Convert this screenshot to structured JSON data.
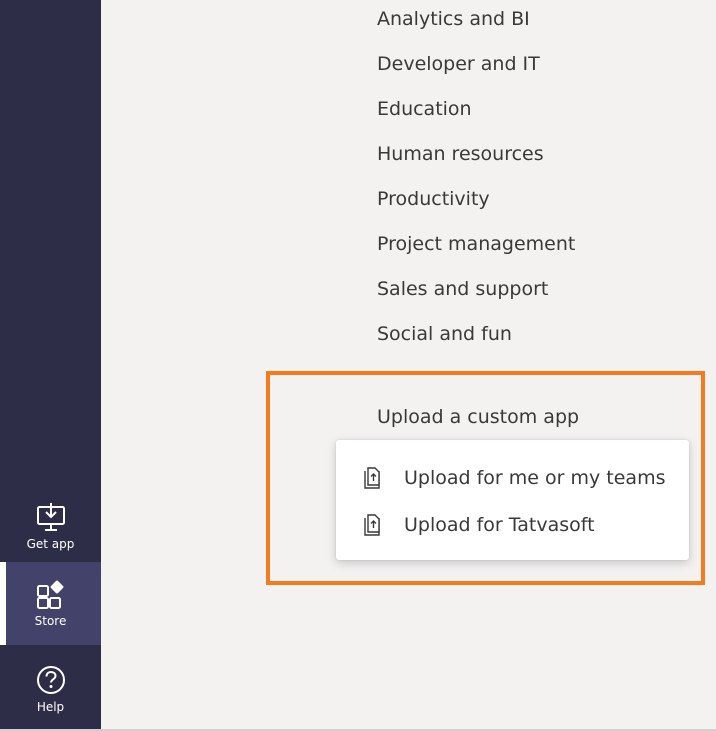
{
  "rail": {
    "items": [
      {
        "label": "Get app",
        "icon": "download-monitor-icon"
      },
      {
        "label": "Store",
        "icon": "store-apps-icon",
        "active": true
      },
      {
        "label": "Help",
        "icon": "help-circle-icon"
      }
    ]
  },
  "categories": [
    "Analytics and BI",
    "Developer and IT",
    "Education",
    "Human resources",
    "Productivity",
    "Project management",
    "Sales and support",
    "Social and fun"
  ],
  "upload": {
    "label": "Upload a custom app",
    "menu": [
      {
        "label": "Upload for me or my teams",
        "icon": "upload-file-icon"
      },
      {
        "label": "Upload for Tatvasoft",
        "icon": "upload-file-icon"
      }
    ]
  },
  "colors": {
    "rail_bg": "#2e2d48",
    "rail_active_bg": "#43426a",
    "highlight": "#f47c20",
    "panel_bg": "#f3f2f1"
  }
}
